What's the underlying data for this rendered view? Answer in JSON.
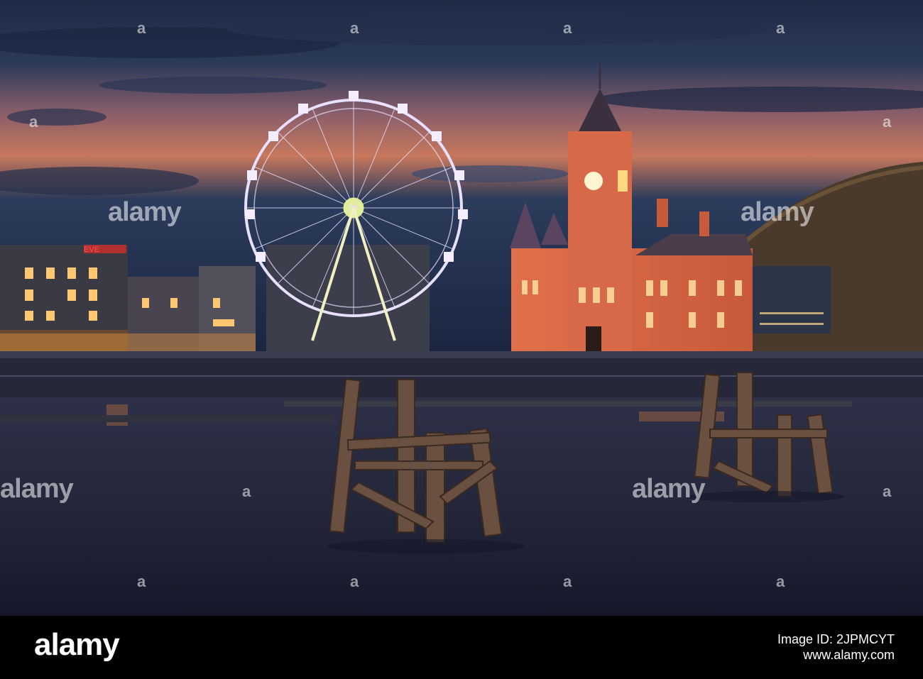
{
  "watermark": {
    "brand": "alamy",
    "dot": "a"
  },
  "storefront_sign": "EVE",
  "footer": {
    "logo": "alamy",
    "image_id_label": "Image ID: 2JPMCYT",
    "site": "www.alamy.com"
  }
}
